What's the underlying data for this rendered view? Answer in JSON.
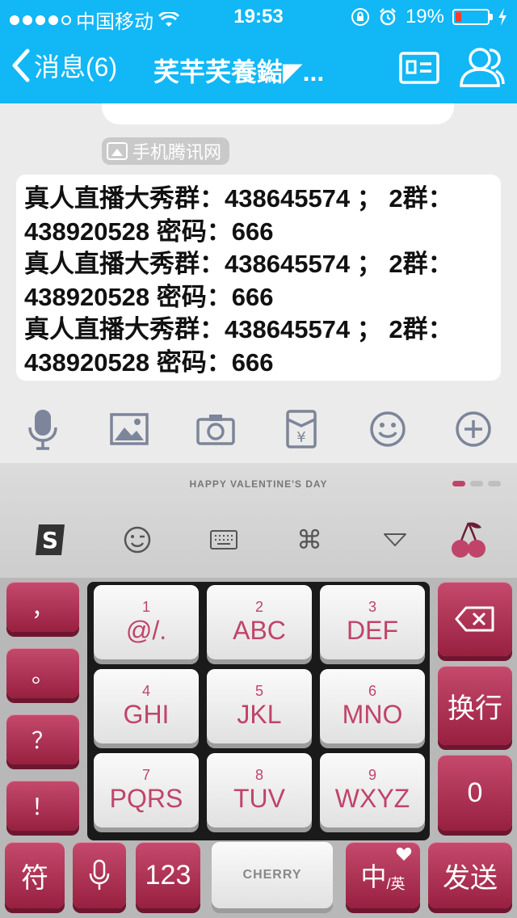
{
  "status_bar": {
    "carrier": "中国移动",
    "time": "19:53",
    "battery": "19%",
    "battery_level": 0.19
  },
  "nav": {
    "back_label": "消息(6)",
    "title": "芺芉芺養鐑◤..."
  },
  "chat": {
    "source_tag": "手机腾讯网",
    "message_lines": [
      "真人直播大秀群：438645574 ； 2群：",
      "438920528 密码：666",
      "真人直播大秀群：438645574 ； 2群：",
      "438920528 密码：666",
      "真人直播大秀群：438645574 ； 2群：",
      "438920528 密码：666"
    ]
  },
  "keyboard": {
    "theme_title": "HAPPY VALENTINE'S DAY",
    "left_keys": [
      "，",
      "。",
      "？",
      "！"
    ],
    "grid_keys": [
      {
        "num": "1",
        "label": "@/."
      },
      {
        "num": "2",
        "label": "ABC"
      },
      {
        "num": "3",
        "label": "DEF"
      },
      {
        "num": "4",
        "label": "GHI"
      },
      {
        "num": "5",
        "label": "JKL"
      },
      {
        "num": "6",
        "label": "MNO"
      },
      {
        "num": "7",
        "label": "PQRS"
      },
      {
        "num": "8",
        "label": "TUV"
      },
      {
        "num": "9",
        "label": "WXYZ"
      }
    ],
    "enter_label": "换行",
    "zero_label": "0",
    "symbol_label": "符",
    "num_label": "123",
    "space_label": "CHERRY",
    "lang_main": "中",
    "lang_sub": "/英",
    "send_label": "发送"
  },
  "colors": {
    "nav_bg": "#12b7f5",
    "accent_pink": "#c0446a",
    "battery_red": "#ff3b30"
  }
}
